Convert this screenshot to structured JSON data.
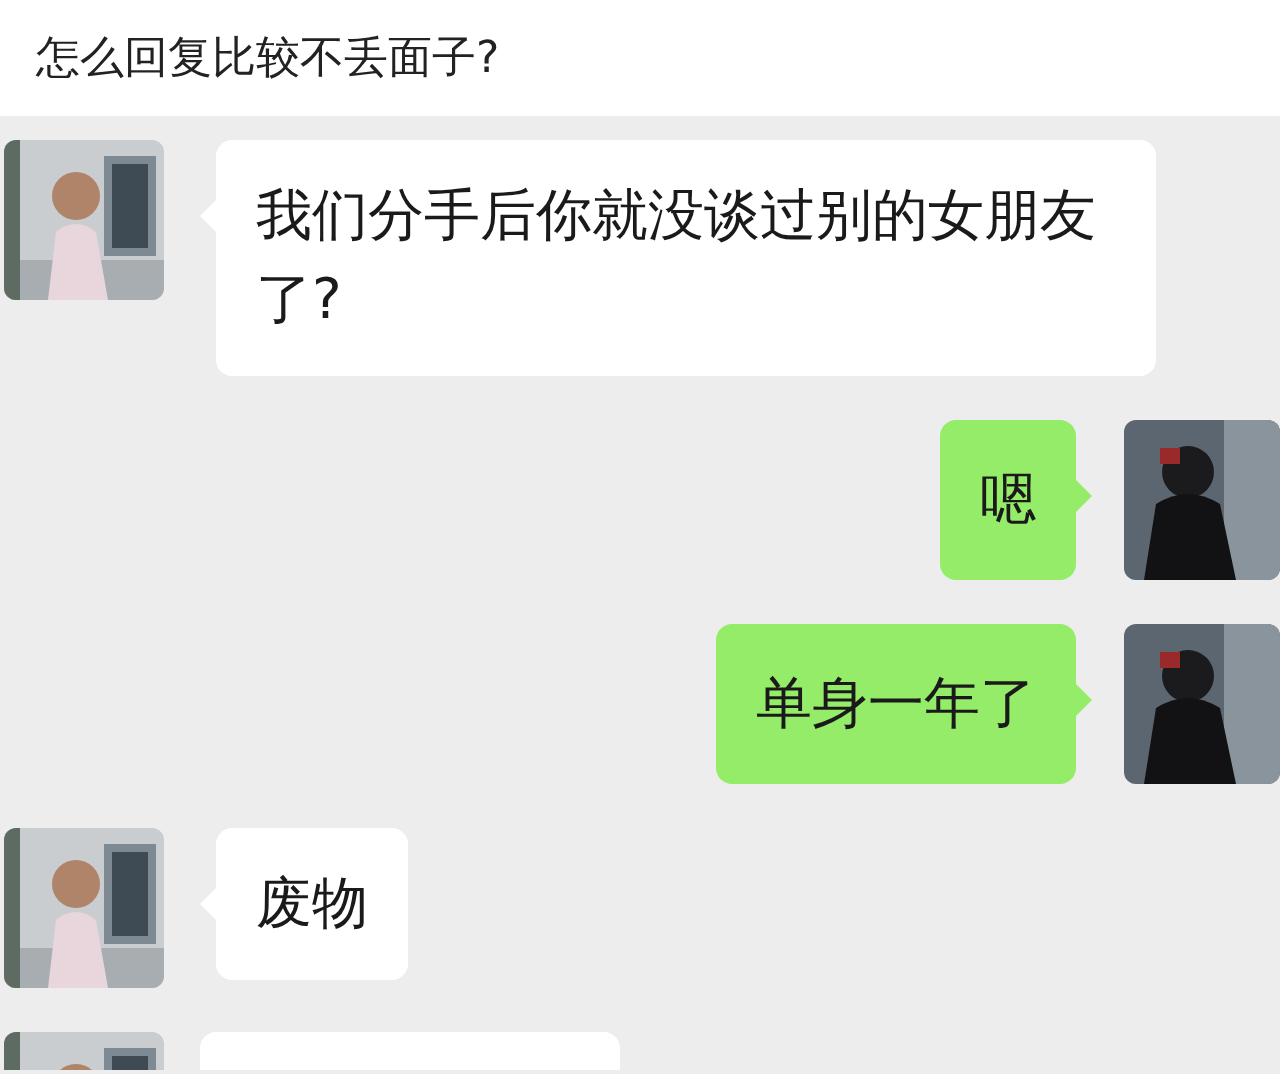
{
  "title": "怎么回复比较不丢面子?",
  "messages": [
    {
      "sent": false,
      "text": "我们分手后你就没谈过别的女朋友了?"
    },
    {
      "sent": true,
      "text": "嗯"
    },
    {
      "sent": true,
      "text": "单身一年了"
    },
    {
      "sent": false,
      "text": "废物"
    },
    {
      "sent": false
    }
  ]
}
